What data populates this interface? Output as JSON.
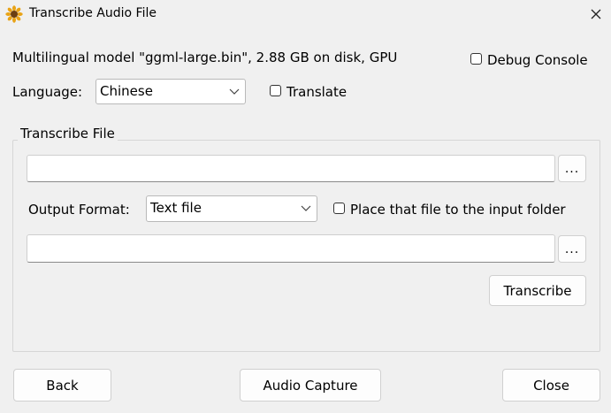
{
  "window": {
    "title": "Transcribe Audio File",
    "icon": "sunflower-icon",
    "close_icon": "close-icon"
  },
  "model_info": "Multilingual model \"ggml-large.bin\", 2.88 GB on disk, GPU",
  "debug_console": {
    "label": "Debug Console",
    "checked": false
  },
  "language": {
    "label": "Language:",
    "selected": "Chinese"
  },
  "translate": {
    "label": "Translate",
    "checked": false
  },
  "transcribe_group": {
    "title": "Transcribe File",
    "input_file": {
      "value": "",
      "browse_label": "..."
    },
    "output_format": {
      "label": "Output Format:",
      "selected": "Text file"
    },
    "place_in_input_folder": {
      "label": "Place that file to the input folder",
      "checked": false
    },
    "output_file": {
      "value": "",
      "browse_label": "..."
    },
    "transcribe_button": "Transcribe"
  },
  "footer": {
    "back_button": "Back",
    "audio_capture_button": "Audio Capture",
    "close_button": "Close"
  }
}
